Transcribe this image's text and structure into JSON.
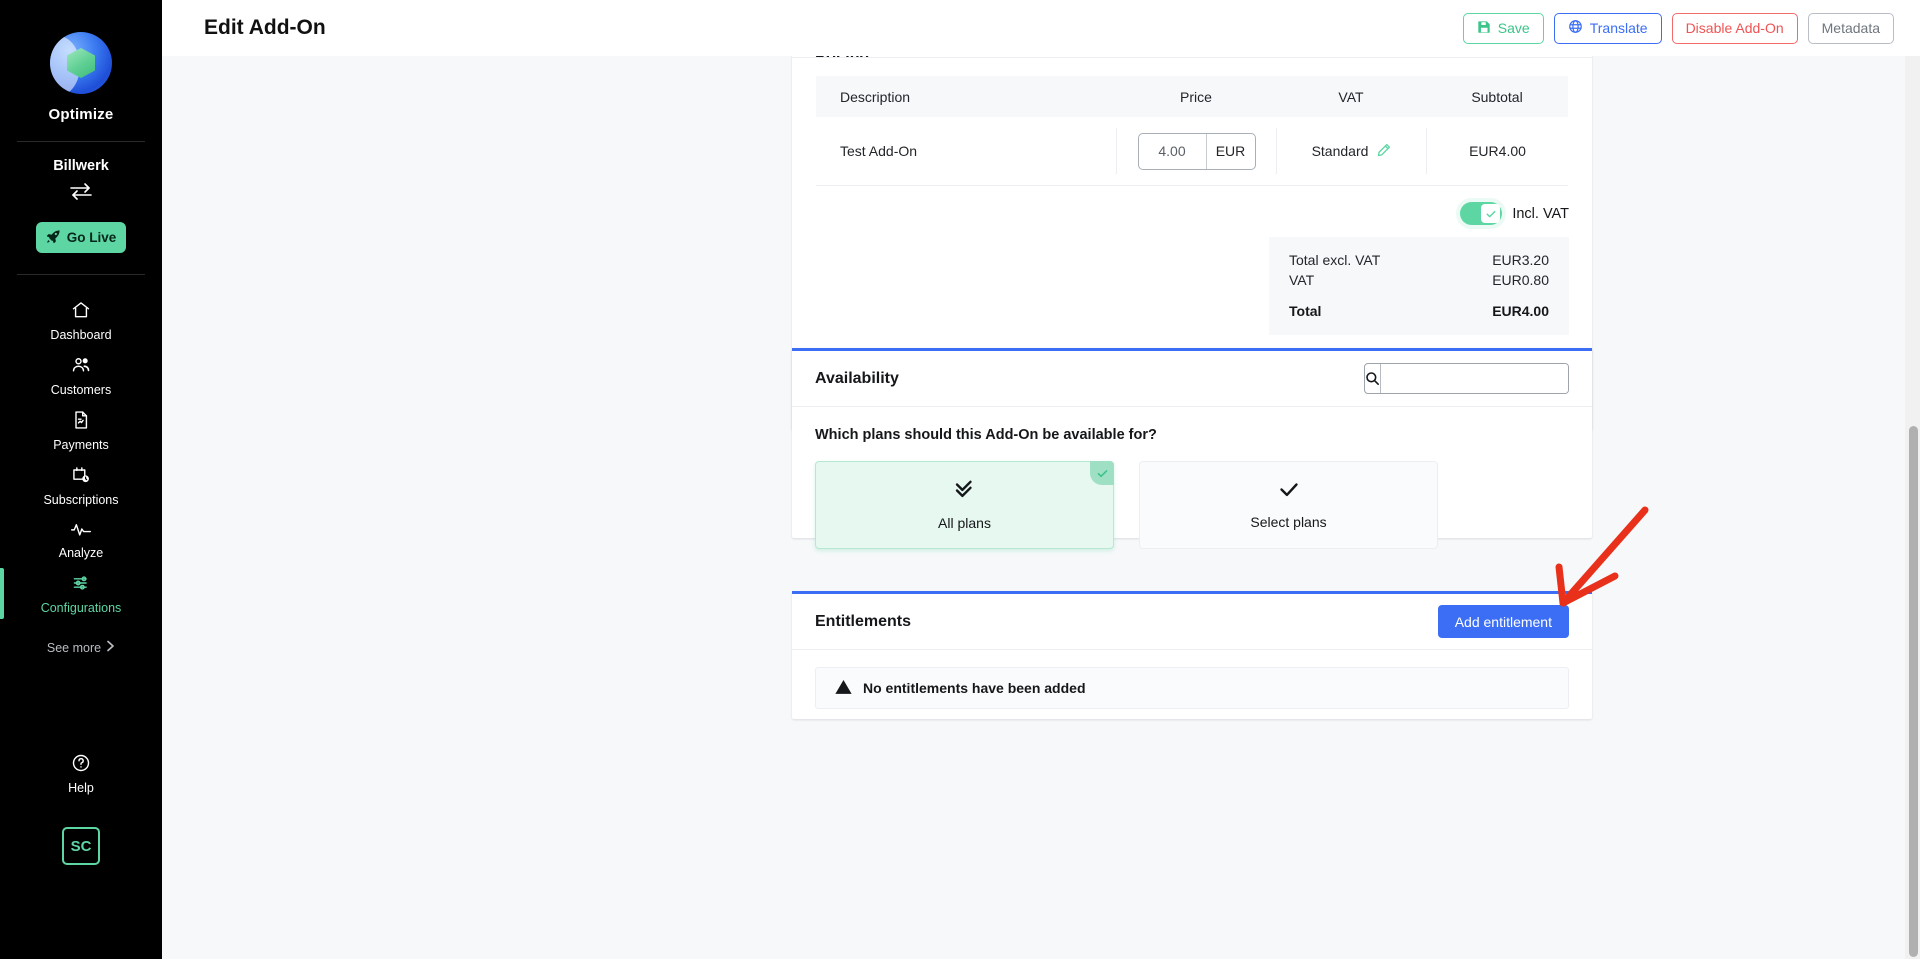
{
  "sidebar": {
    "logo_name": "logo-globe",
    "brand": "Optimize",
    "org": "Billwerk",
    "swap_icon": "swap-arrows-icon",
    "go_live": "Go Live",
    "nav": [
      {
        "label": "Dashboard",
        "icon": "home-icon",
        "active": false
      },
      {
        "label": "Customers",
        "icon": "users-icon",
        "active": false
      },
      {
        "label": "Payments",
        "icon": "document-icon",
        "active": false
      },
      {
        "label": "Subscriptions",
        "icon": "calendar-clock-icon",
        "active": false
      },
      {
        "label": "Analyze",
        "icon": "pulse-icon",
        "active": false
      },
      {
        "label": "Configurations",
        "icon": "sliders-icon",
        "active": true
      }
    ],
    "see_more": "See more",
    "help": "Help",
    "avatar": "SC"
  },
  "topbar": {
    "title": "Edit Add-On",
    "save": "Save",
    "translate": "Translate",
    "disable": "Disable Add-On",
    "metadata": "Metadata"
  },
  "pricing": {
    "title": "Pricing",
    "columns": {
      "description": "Description",
      "price": "Price",
      "vat": "VAT",
      "subtotal": "Subtotal"
    },
    "row": {
      "description": "Test Add-On",
      "price_value": "4.00",
      "currency": "EUR",
      "vat": "Standard",
      "subtotal": "EUR4.00"
    },
    "incl_vat_label": "Incl. VAT",
    "incl_vat_checked": true,
    "totals": [
      {
        "label": "Total excl. VAT",
        "value": "EUR3.20",
        "bold": false
      },
      {
        "label": "VAT",
        "value": "EUR0.80",
        "bold": false
      },
      {
        "label": "Total",
        "value": "EUR4.00",
        "bold": true
      }
    ]
  },
  "availability": {
    "title": "Availability",
    "search_value": "",
    "search_placeholder": "",
    "question": "Which plans should this Add-On be available for?",
    "options": [
      {
        "label": "All plans",
        "selected": true
      },
      {
        "label": "Select plans",
        "selected": false
      }
    ]
  },
  "entitlements": {
    "title": "Entitlements",
    "add_button": "Add entitlement",
    "empty_message": "No entitlements have been added"
  },
  "colors": {
    "accent_green": "#5ed6a4",
    "accent_blue": "#3b6ef5",
    "danger_red": "#ef5454",
    "annotation_red": "#e8301b",
    "sidebar_bg": "#000000",
    "page_bg": "#f7f8fa"
  }
}
